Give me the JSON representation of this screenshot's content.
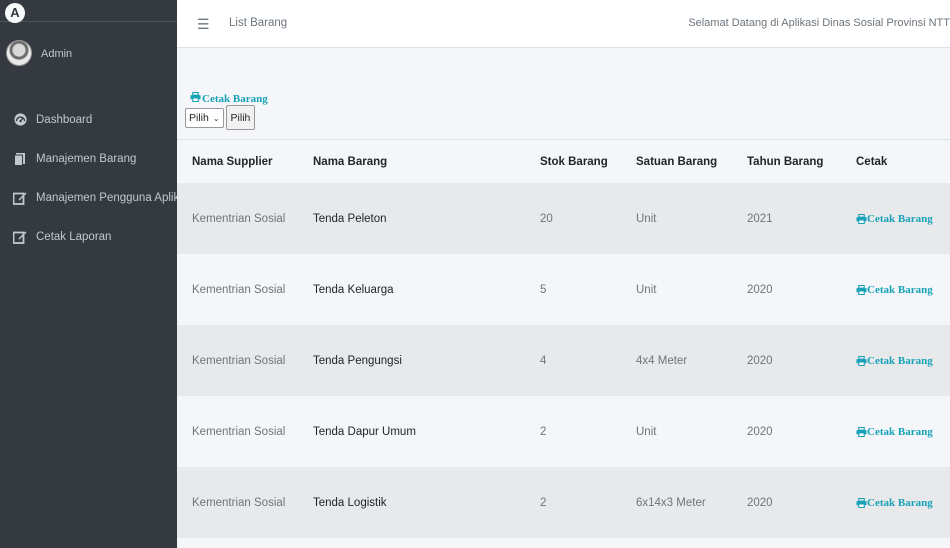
{
  "sidebar": {
    "brand_logo": "A",
    "user_name": "Admin",
    "items": [
      {
        "label": "Dashboard",
        "icon": "dashboard-icon"
      },
      {
        "label": "Manajemen Barang",
        "icon": "clipboard-icon"
      },
      {
        "label": "Manajemen Pengguna Aplik",
        "icon": "edit-icon"
      },
      {
        "label": "Cetak Laporan",
        "icon": "edit-icon"
      }
    ]
  },
  "header": {
    "title": "List Barang",
    "welcome": "Selamat Datang di Aplikasi Dinas Sosial Provinsi NTT"
  },
  "toolbar": {
    "print_label": "Cetak Barang",
    "select_value": "Pilih",
    "pilih_button": "Pilih"
  },
  "table": {
    "headers": [
      "Nama Supplier",
      "Nama Barang",
      "Stok Barang",
      "Satuan Barang",
      "Tahun Barang",
      "Cetak"
    ],
    "rows": [
      {
        "supplier": "Kementrian Sosial",
        "barang": "Tenda Peleton",
        "stok": "20",
        "satuan": "Unit",
        "tahun": "2021",
        "cetak": "Cetak Barang"
      },
      {
        "supplier": "Kementrian Sosial",
        "barang": "Tenda Keluarga",
        "stok": "5",
        "satuan": "Unit",
        "tahun": "2020",
        "cetak": "Cetak Barang"
      },
      {
        "supplier": "Kementrian Sosial",
        "barang": "Tenda Pengungsi",
        "stok": "4",
        "satuan": "4x4 Meter",
        "tahun": "2020",
        "cetak": "Cetak Barang"
      },
      {
        "supplier": "Kementrian Sosial",
        "barang": "Tenda Dapur Umum",
        "stok": "2",
        "satuan": "Unit",
        "tahun": "2020",
        "cetak": "Cetak Barang"
      },
      {
        "supplier": "Kementrian Sosial",
        "barang": "Tenda Logistik",
        "stok": "2",
        "satuan": "6x14x3 Meter",
        "tahun": "2020",
        "cetak": "Cetak Barang"
      }
    ]
  },
  "colors": {
    "sidebar_bg": "#343a40",
    "accent": "#17a2b8",
    "row_stripe": "#e8e9eb"
  }
}
